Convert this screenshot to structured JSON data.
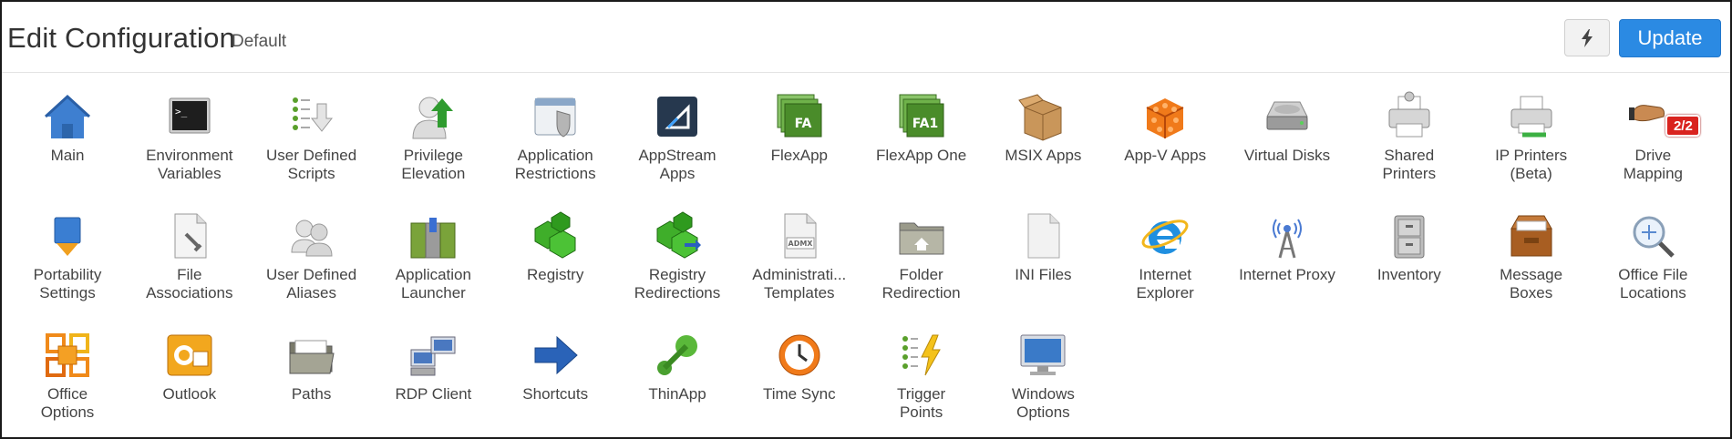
{
  "header": {
    "title": "Edit Configuration",
    "subtitle": "Default",
    "update_label": "Update"
  },
  "items": [
    {
      "label": "Main",
      "icon": "home-icon"
    },
    {
      "label": "Environment\nVariables",
      "icon": "terminal-icon"
    },
    {
      "label": "User Defined\nScripts",
      "icon": "script-list-icon"
    },
    {
      "label": "Privilege\nElevation",
      "icon": "user-elevate-icon"
    },
    {
      "label": "Application\nRestrictions",
      "icon": "window-shield-icon"
    },
    {
      "label": "AppStream\nApps",
      "icon": "appstream-icon"
    },
    {
      "label": "FlexApp",
      "icon": "flexapp-icon",
      "glyph": "FA"
    },
    {
      "label": "FlexApp One",
      "icon": "flexapp-one-icon",
      "glyph": "FA1"
    },
    {
      "label": "MSIX Apps",
      "icon": "box-icon"
    },
    {
      "label": "App-V Apps",
      "icon": "appv-cube-icon"
    },
    {
      "label": "Virtual Disks",
      "icon": "hard-disk-icon"
    },
    {
      "label": "Shared\nPrinters",
      "icon": "printer-icon"
    },
    {
      "label": "IP Printers\n(Beta)",
      "icon": "ip-printer-icon"
    },
    {
      "label": "Drive\nMapping",
      "icon": "drive-mapping-icon",
      "badge": "2/2"
    },
    {
      "label": "Portability\nSettings",
      "icon": "portability-icon"
    },
    {
      "label": "File\nAssociations",
      "icon": "file-wrench-icon"
    },
    {
      "label": "User Defined\nAliases",
      "icon": "users-icon"
    },
    {
      "label": "Application\nLauncher",
      "icon": "launcher-icon"
    },
    {
      "label": "Registry",
      "icon": "registry-icon"
    },
    {
      "label": "Registry\nRedirections",
      "icon": "registry-redirect-icon"
    },
    {
      "label": "Administrati...\nTemplates",
      "icon": "admx-file-icon",
      "glyph": "ADMX"
    },
    {
      "label": "Folder\nRedirection",
      "icon": "folder-home-icon"
    },
    {
      "label": "INI Files",
      "icon": "document-icon"
    },
    {
      "label": "Internet\nExplorer",
      "icon": "internet-explorer-icon"
    },
    {
      "label": "Internet Proxy",
      "icon": "antenna-icon"
    },
    {
      "label": "Inventory",
      "icon": "cabinet-icon"
    },
    {
      "label": "Message\nBoxes",
      "icon": "inbox-tray-icon"
    },
    {
      "label": "Office File\nLocations",
      "icon": "magnifier-icon"
    },
    {
      "label": "Office\nOptions",
      "icon": "office-logo-icon"
    },
    {
      "label": "Outlook",
      "icon": "outlook-icon"
    },
    {
      "label": "Paths",
      "icon": "folder-open-icon"
    },
    {
      "label": "RDP Client",
      "icon": "rdp-computers-icon"
    },
    {
      "label": "Shortcuts",
      "icon": "arrow-right-icon"
    },
    {
      "label": "ThinApp",
      "icon": "thinapp-icon"
    },
    {
      "label": "Time Sync",
      "icon": "clock-icon"
    },
    {
      "label": "Trigger\nPoints",
      "icon": "trigger-list-icon"
    },
    {
      "label": "Windows\nOptions",
      "icon": "monitor-icon"
    }
  ]
}
